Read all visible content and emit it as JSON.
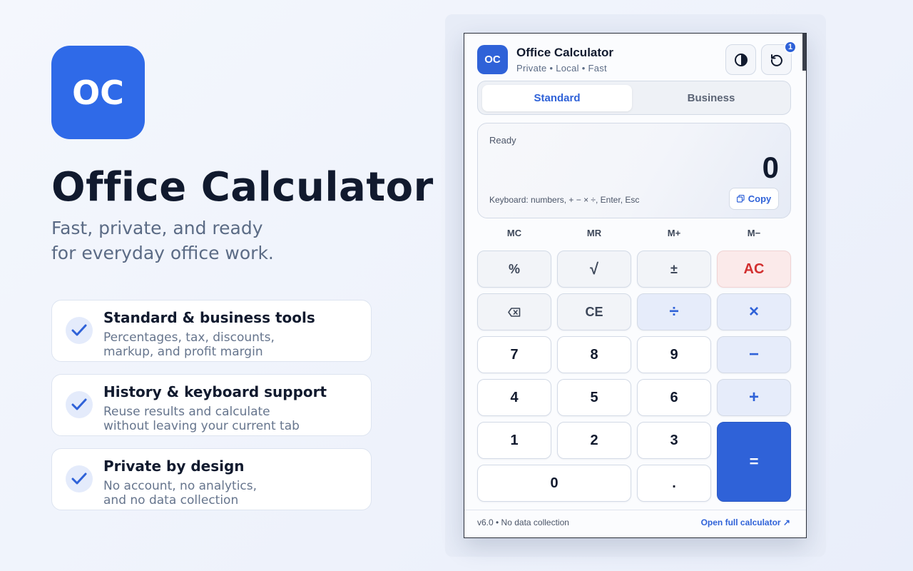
{
  "brand": {
    "logo_text": "OC"
  },
  "hero": {
    "title": "Office Calculator",
    "subtitle_line1": "Fast, private, and ready",
    "subtitle_line2": "for everyday office work."
  },
  "features": [
    {
      "title": "Standard & business tools",
      "desc_line1": "Percentages, tax, discounts,",
      "desc_line2": "markup, and profit margin"
    },
    {
      "title": "History & keyboard support",
      "desc_line1": "Reuse results and calculate",
      "desc_line2": "without leaving your current tab"
    },
    {
      "title": "Private by design",
      "desc_line1": "No account, no analytics,",
      "desc_line2": "and no data collection"
    }
  ],
  "popup": {
    "icon_text": "OC",
    "title": "Office Calculator",
    "tagline": "Private • Local • Fast",
    "history_badge": "1",
    "tabs": [
      {
        "label": "Standard",
        "active": true
      },
      {
        "label": "Business",
        "active": false
      }
    ],
    "display": {
      "status": "Ready",
      "value": "0",
      "hint": "Keyboard: numbers, + − × ÷, Enter, Esc",
      "copy_label": "Copy"
    },
    "memory": [
      "MC",
      "MR",
      "M+",
      "M−"
    ],
    "keys": {
      "percent": "%",
      "sqrt": "√",
      "plusminus": "±",
      "ac": "AC",
      "backspace": "⌫",
      "ce": "CE",
      "divide": "÷",
      "multiply": "×",
      "seven": "7",
      "eight": "8",
      "nine": "9",
      "minus": "−",
      "four": "4",
      "five": "5",
      "six": "6",
      "plus": "+",
      "one": "1",
      "two": "2",
      "three": "3",
      "equals": "=",
      "zero": "0",
      "decimal": "."
    },
    "footer": {
      "version": "v6.0 • No data collection",
      "link": "Open full calculator ↗"
    },
    "colors": {
      "accent": "#2f62d8",
      "danger": "#d22f2f",
      "text": "#111a2e"
    }
  }
}
